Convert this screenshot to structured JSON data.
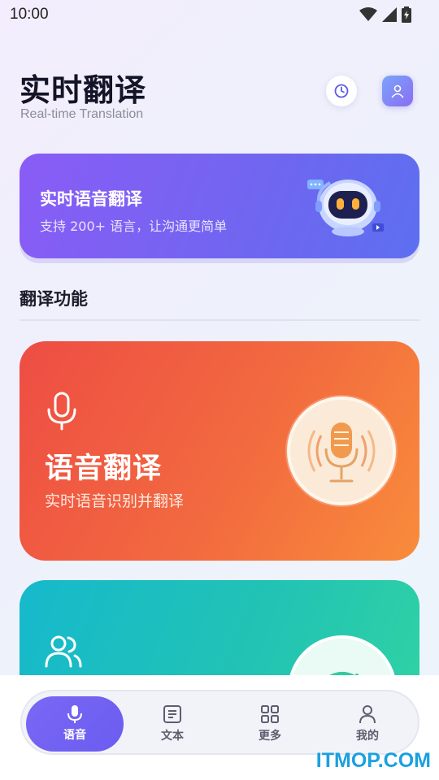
{
  "status": {
    "time": "10:00"
  },
  "header": {
    "title": "实时翻译",
    "subtitle": "Real-time Translation"
  },
  "banner": {
    "title": "实时语音翻译",
    "subtitle": "支持 200+ 语言，让沟通更简单"
  },
  "section": {
    "title": "翻译功能"
  },
  "cards": [
    {
      "title": "语音翻译",
      "subtitle": "实时语音识别并翻译",
      "icon": "microphone-icon"
    },
    {
      "title": "",
      "subtitle": "",
      "icon": "users-icon"
    }
  ],
  "nav": {
    "items": [
      {
        "label": "语音",
        "icon": "microphone-icon",
        "active": true
      },
      {
        "label": "文本",
        "icon": "document-icon",
        "active": false
      },
      {
        "label": "更多",
        "icon": "grid-icon",
        "active": false
      },
      {
        "label": "我的",
        "icon": "user-icon",
        "active": false
      }
    ]
  },
  "watermark": "ITMOP.COM",
  "colors": {
    "accent": "#6f66f0",
    "voice_card": "#f26a3f",
    "convo_card": "#22c3b4",
    "nav_active": "#7a68f5"
  }
}
